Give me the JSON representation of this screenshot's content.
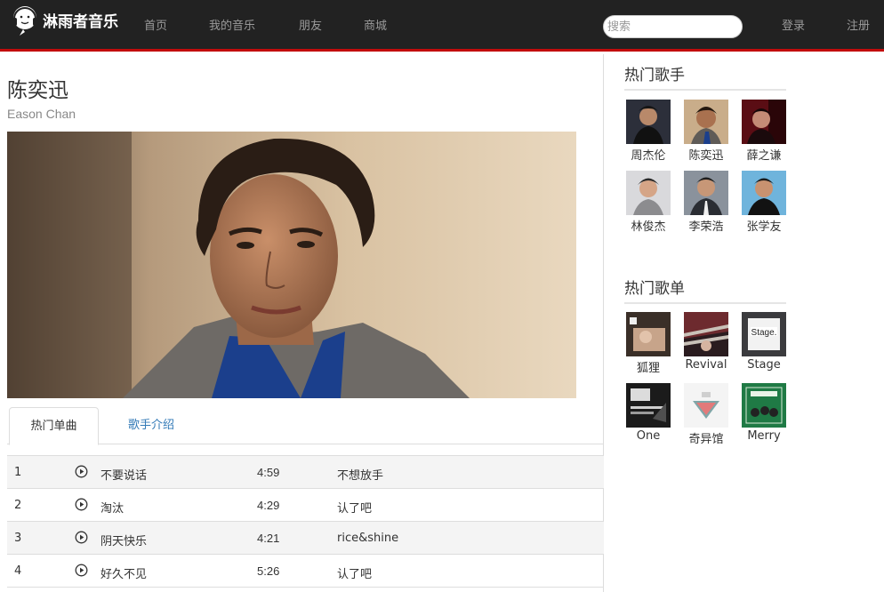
{
  "header": {
    "logo_text": "淋雨者音乐",
    "nav": [
      "首页",
      "我的音乐",
      "朋友",
      "商城"
    ],
    "search_placeholder": "搜索",
    "login": "登录",
    "register": "注册"
  },
  "artist": {
    "name": "陈奕迅",
    "english_name": "Eason Chan"
  },
  "tabs": [
    "热门单曲",
    "歌手介绍"
  ],
  "songs": [
    {
      "num": "1",
      "title": "不要说话",
      "duration": "4:59",
      "album": "不想放手"
    },
    {
      "num": "2",
      "title": "淘汰",
      "duration": "4:29",
      "album": "认了吧"
    },
    {
      "num": "3",
      "title": "阴天快乐",
      "duration": "4:21",
      "album": "rice&shine"
    },
    {
      "num": "4",
      "title": "好久不见",
      "duration": "5:26",
      "album": "认了吧"
    }
  ],
  "sidebar": {
    "hot_singers_title": "热门歌手",
    "hot_singers": [
      "周杰伦",
      "陈奕迅",
      "薛之谦",
      "林俊杰",
      "李荣浩",
      "张学友"
    ],
    "hot_playlists_title": "热门歌单",
    "hot_playlists": [
      "狐狸",
      "Revival",
      "Stage",
      "One",
      "奇异馆",
      "Merry"
    ]
  },
  "colors": {
    "header_bg": "#222222",
    "accent_red": "#c20c0c",
    "link_blue": "#337ab7"
  }
}
